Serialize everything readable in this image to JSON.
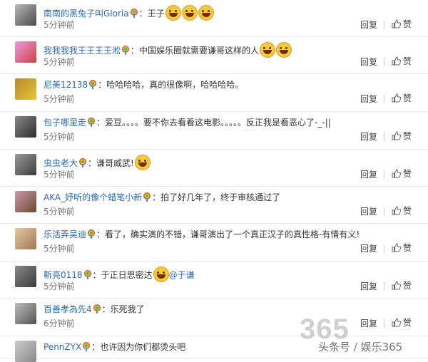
{
  "comments": [
    {
      "user": "南南的黑兔子叫Gloria",
      "text": "王子",
      "emojis": 3,
      "time": "5分钟前"
    },
    {
      "user": "我我我我王王王王淞",
      "text": "中国娱乐圈就需要谦哥这样的人",
      "emojis": 2,
      "time": "5分钟前"
    },
    {
      "user": "尼美12138",
      "text": "哈哈哈哈，真的很像啊，哈哈哈哈。",
      "emojis": 0,
      "time": "5分钟前"
    },
    {
      "user": "包子哪里走",
      "text": "爱豆。。。。要不你去看看这电影。。。。。反正我是看恶心了-_-||",
      "emojis": 0,
      "time": "5分钟前"
    },
    {
      "user": "虫虫老大",
      "text": "谦哥威武!",
      "emojis": 1,
      "time": "5分钟前"
    },
    {
      "user": "AKA_妤听的像个蜡笔小新",
      "text": "拍了好几年了，终于审核通过了",
      "emojis": 0,
      "time": "5分钟前"
    },
    {
      "user": "乐活弄吴迪",
      "text": "看了，确实演的不错，谦哥演出了一个真正汉子的真性格-有情有义!",
      "emojis": 0,
      "time": "5分钟前"
    },
    {
      "user": "靳亮0118",
      "text": "于正日思密达",
      "emojis": 1,
      "mention": "@于谦",
      "time": "5分钟前"
    },
    {
      "user": "百善孝為先4",
      "text": "乐死我了",
      "emojis": 0,
      "time": "6分钟前"
    },
    {
      "user": "PennZYX",
      "text": "也许因为你们都烫头吧",
      "emojis": 0,
      "time": ""
    }
  ],
  "actions": {
    "reply": "回复",
    "like": "赞"
  },
  "colors": {
    "link": "#2a6ab0",
    "separator": "#e6e6e6"
  },
  "watermark": {
    "big": "365",
    "small": "头条号 / 娱乐365"
  }
}
